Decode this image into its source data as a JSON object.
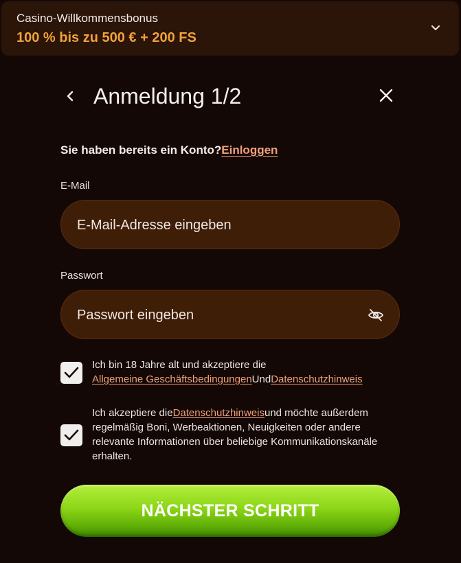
{
  "bonus": {
    "title": "Casino-Willkommensbonus",
    "value": "100 % bis zu 500 € + 200 FS",
    "expand_icon": "chevron-down-icon"
  },
  "header": {
    "title": "Anmeldung 1/2",
    "back_icon": "chevron-left-icon",
    "close_icon": "close-icon"
  },
  "login": {
    "prompt": "Sie haben bereits ein Konto?",
    "link": "Einloggen"
  },
  "email": {
    "label": "E-Mail",
    "placeholder": "E-Mail-Adresse eingeben",
    "value": ""
  },
  "password": {
    "label": "Passwort",
    "placeholder": "Passwort eingeben",
    "value": "",
    "toggle_icon": "eye-off-icon"
  },
  "terms": {
    "checked": true,
    "text_line1": "Ich bin 18 Jahre alt und akzeptiere die",
    "link_terms": "Allgemeine Geschäftsbedingungen",
    "connector": "Und",
    "link_privacy": "Datenschutzhinweis"
  },
  "marketing": {
    "checked": true,
    "text_before": "Ich akzeptiere die",
    "link_privacy": "Datenschutzhinweis",
    "text_after": "und möchte außerdem regelmäßig Boni, Werbeaktionen, Neuigkeiten oder andere relevante Informationen über beliebige Kommunikationskanäle erhalten."
  },
  "next_button": {
    "label": "NÄCHSTER SCHRITT"
  },
  "colors": {
    "background": "#130806",
    "banner": "#2b1408",
    "accent_orange": "#f0a23a",
    "link": "#f2a07a",
    "field": "#3f1e08",
    "button_green": "#8cd617"
  }
}
